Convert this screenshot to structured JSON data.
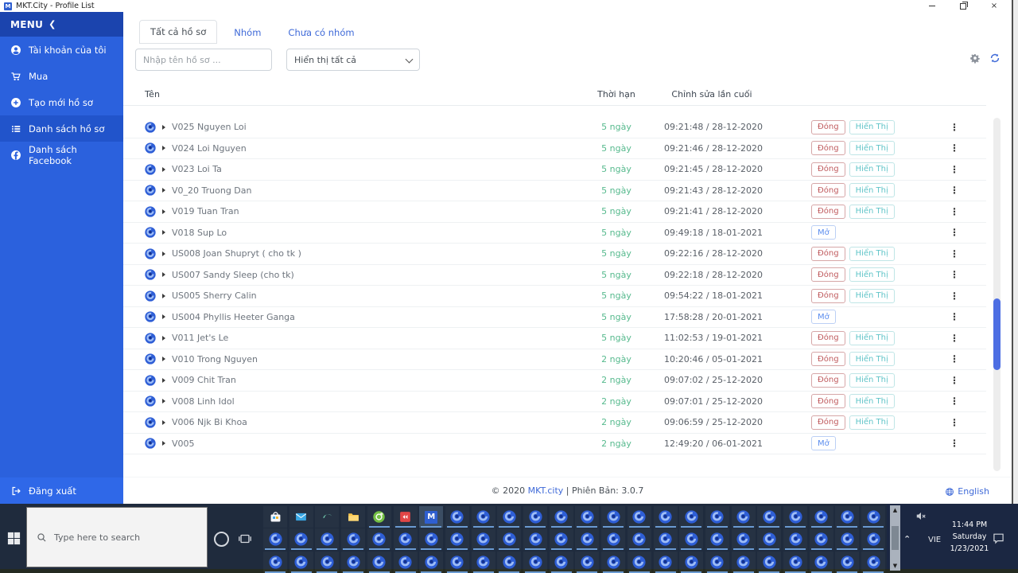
{
  "window": {
    "title": "MKT.City - Profile List",
    "logo_letter": "M"
  },
  "sidebar": {
    "menu_label": "MENU",
    "menu_collapse_glyph": "❮",
    "items": [
      {
        "label": "Tài khoản của tôi"
      },
      {
        "label": "Mua"
      },
      {
        "label": "Tạo mới hồ sơ"
      },
      {
        "label": "Danh sách hồ sơ"
      },
      {
        "label": "Danh sách Facebook"
      }
    ],
    "logout_label": "Đăng xuất"
  },
  "tabs": {
    "all": "Tất cả hồ sơ",
    "group": "Nhóm",
    "no_group": "Chưa có nhóm"
  },
  "filters": {
    "search_placeholder": "Nhập tên hồ sơ ...",
    "display_filter_value": "Hiển thị tất cả"
  },
  "table": {
    "columns": {
      "name": "Tên",
      "duration": "Thời hạn",
      "modified": "Chỉnh sửa lần cuối"
    },
    "action_labels": {
      "close": "Đóng",
      "show": "Hiển Thị",
      "open": "Mở"
    },
    "kebab_glyph": "⋮",
    "rows": [
      {
        "name": "V025 Nguyen Loi",
        "duration": "5 ngày",
        "modified": "09:21:48 / 28-12-2020",
        "actions": [
          "close",
          "show"
        ]
      },
      {
        "name": "V024 Loi Nguyen",
        "duration": "5 ngày",
        "modified": "09:21:46 / 28-12-2020",
        "actions": [
          "close",
          "show"
        ]
      },
      {
        "name": "V023 Loi Ta",
        "duration": "5 ngày",
        "modified": "09:21:45 / 28-12-2020",
        "actions": [
          "close",
          "show"
        ]
      },
      {
        "name": "V0_20 Truong Dan",
        "duration": "5 ngày",
        "modified": "09:21:43 / 28-12-2020",
        "actions": [
          "close",
          "show"
        ]
      },
      {
        "name": "V019 Tuan Tran",
        "duration": "5 ngày",
        "modified": "09:21:41 / 28-12-2020",
        "actions": [
          "close",
          "show"
        ]
      },
      {
        "name": "V018 Sup Lo",
        "duration": "5 ngày",
        "modified": "09:49:18 / 18-01-2021",
        "actions": [
          "open"
        ]
      },
      {
        "name": "US008 Joan Shupryt ( cho tk )",
        "duration": "5 ngày",
        "modified": "09:22:16 / 28-12-2020",
        "actions": [
          "close",
          "show"
        ]
      },
      {
        "name": "US007 Sandy Sleep (cho tk)",
        "duration": "5 ngày",
        "modified": "09:22:18 / 28-12-2020",
        "actions": [
          "close",
          "show"
        ]
      },
      {
        "name": "US005 Sherry Calin",
        "duration": "5 ngày",
        "modified": "09:54:22 / 18-01-2021",
        "actions": [
          "close",
          "show"
        ]
      },
      {
        "name": "US004 Phyllis Heeter Ganga",
        "duration": "5 ngày",
        "modified": "17:58:28 / 20-01-2021",
        "actions": [
          "open"
        ]
      },
      {
        "name": "V011 Jet's Le",
        "duration": "5 ngày",
        "modified": "11:02:53 / 19-01-2021",
        "actions": [
          "close",
          "show"
        ]
      },
      {
        "name": "V010 Trong Nguyen",
        "duration": "2 ngày",
        "modified": "10:20:46 / 05-01-2021",
        "actions": [
          "close",
          "show"
        ]
      },
      {
        "name": "V009 Chit Tran",
        "duration": "2 ngày",
        "modified": "09:07:02 / 25-12-2020",
        "actions": [
          "close",
          "show"
        ]
      },
      {
        "name": "V008 Linh Idol",
        "duration": "2 ngày",
        "modified": "09:07:01 / 25-12-2020",
        "actions": [
          "close",
          "show"
        ]
      },
      {
        "name": "V006 Njk Bi Khoa",
        "duration": "2 ngày",
        "modified": "09:06:59 / 25-12-2020",
        "actions": [
          "close",
          "show"
        ]
      },
      {
        "name": "V005",
        "duration": "2 ngày",
        "modified": "12:49:20 / 06-01-2021",
        "actions": [
          "open"
        ]
      }
    ]
  },
  "footer": {
    "copyright_prefix": "© 2020 ",
    "brand_link": "MKT.city",
    "version_suffix": " | Phiên Bản: 3.0.7",
    "language": "English"
  },
  "taskbar": {
    "search_placeholder": "Type here to search",
    "app_letter": "M",
    "grid": {
      "row1_pinned": [
        "store",
        "mail",
        "edge",
        "folder",
        "green-app",
        "red-app",
        "mkt"
      ],
      "row1_chrome_count": 17,
      "row2_chrome_count": 24,
      "row3_chrome_count": 24
    },
    "tray": {
      "language": "VIE",
      "time": "11:44 PM",
      "day": "Saturday",
      "date": "1/23/2021"
    }
  },
  "colors": {
    "sidebar_blue": "#2b61dd",
    "sidebar_header_blue": "#1b44ae",
    "sidebar_active_blue": "#2154cb",
    "link_blue": "#3f6ad8",
    "duration_green": "#57ba8e",
    "close_red": "#c05b5e",
    "show_teal": "#5fc4c8",
    "open_blue": "#5b8def",
    "scroll_thumb_blue": "#4d6ee3",
    "taskbar_dark": "#1f2b3d"
  }
}
